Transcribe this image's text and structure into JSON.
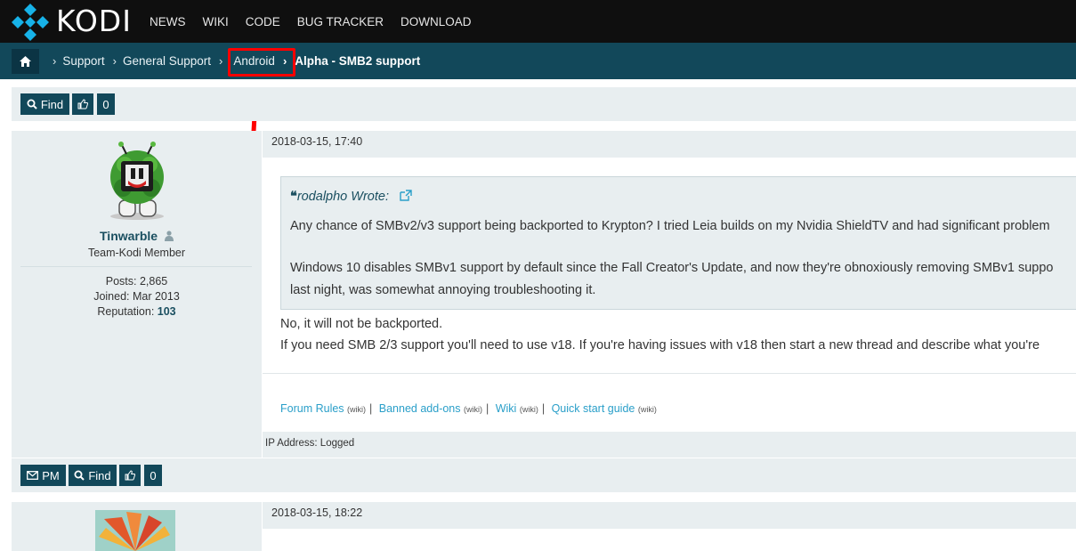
{
  "brand": {
    "name": "KODI"
  },
  "nav": [
    "NEWS",
    "WIKI",
    "CODE",
    "BUG TRACKER",
    "DOWNLOAD"
  ],
  "breadcrumb": {
    "items": [
      "Support",
      "General Support",
      "Android"
    ],
    "current": "Alpha -  SMB2 support"
  },
  "top_toolbar": {
    "find_label": "Find",
    "like_count": "0"
  },
  "post1": {
    "date": "2018-03-15, 17:40",
    "author": {
      "name": "Tinwarble",
      "role": "Team-Kodi Member",
      "posts_label": "Posts:",
      "posts": "2,865",
      "joined_label": "Joined:",
      "joined": "Mar 2013",
      "reputation_label": "Reputation:",
      "reputation": "103"
    },
    "quote": {
      "author_wrote": "rodalpho Wrote:",
      "line1": "Any chance of SMBv2/v3 support being backported to Krypton? I tried Leia builds on my Nvidia ShieldTV and had significant problem",
      "line2": "Windows 10 disables SMBv1 support by default since the Fall Creator's Update, and now they're obnoxiously removing SMBv1 suppo",
      "line3": "last night, was somewhat annoying troubleshooting it."
    },
    "body_line1": "No, it will not be backported.",
    "body_line2": "If you need SMB 2/3 support you'll need to use v18.  If you're having issues with v18 then start a new thread and describe what you're",
    "signature": [
      {
        "label": "Forum Rules",
        "tag": "(wiki)"
      },
      {
        "label": "Banned add-ons",
        "tag": "(wiki)"
      },
      {
        "label": "Wiki",
        "tag": "(wiki)"
      },
      {
        "label": "Quick start guide",
        "tag": "(wiki)"
      }
    ],
    "ip_address": "IP Address: Logged",
    "toolbar": {
      "pm_label": "PM",
      "find_label": "Find",
      "like_count": "0"
    }
  },
  "post2": {
    "date": "2018-03-15, 18:22"
  },
  "colors": {
    "accent": "#12485a",
    "highlight": "#ff0000",
    "link": "#2a9fc9"
  }
}
